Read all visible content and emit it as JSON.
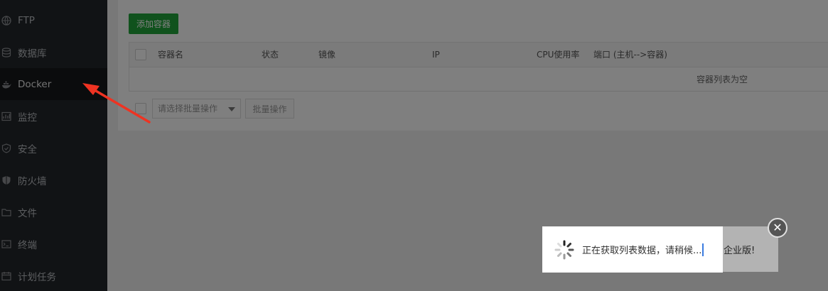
{
  "sidebar": {
    "items": [
      {
        "label": "FTP",
        "icon": "globe-icon"
      },
      {
        "label": "数据库",
        "icon": "database-icon"
      },
      {
        "label": "Docker",
        "icon": "docker-icon",
        "active": true
      },
      {
        "label": "监控",
        "icon": "monitor-icon"
      },
      {
        "label": "安全",
        "icon": "shield-icon"
      },
      {
        "label": "防火墙",
        "icon": "firewall-icon"
      },
      {
        "label": "文件",
        "icon": "folder-icon"
      },
      {
        "label": "终端",
        "icon": "terminal-icon"
      },
      {
        "label": "计划任务",
        "icon": "calendar-icon"
      }
    ]
  },
  "toolbar": {
    "add_container_label": "添加容器"
  },
  "table": {
    "columns": [
      "容器名",
      "状态",
      "镜像",
      "IP",
      "CPU使用率",
      "端口 (主机-->容器)"
    ],
    "empty_text": "容器列表为空"
  },
  "batch": {
    "select_placeholder": "请选择批量操作",
    "button_label": "批量操作"
  },
  "loading": {
    "text": "正在获取列表数据，请稍候..."
  },
  "back_dialog": {
    "text": "企业版!"
  },
  "colors": {
    "accent": "#20a53a",
    "sidebar_bg": "#23262b",
    "arrow": "#ee3322"
  }
}
